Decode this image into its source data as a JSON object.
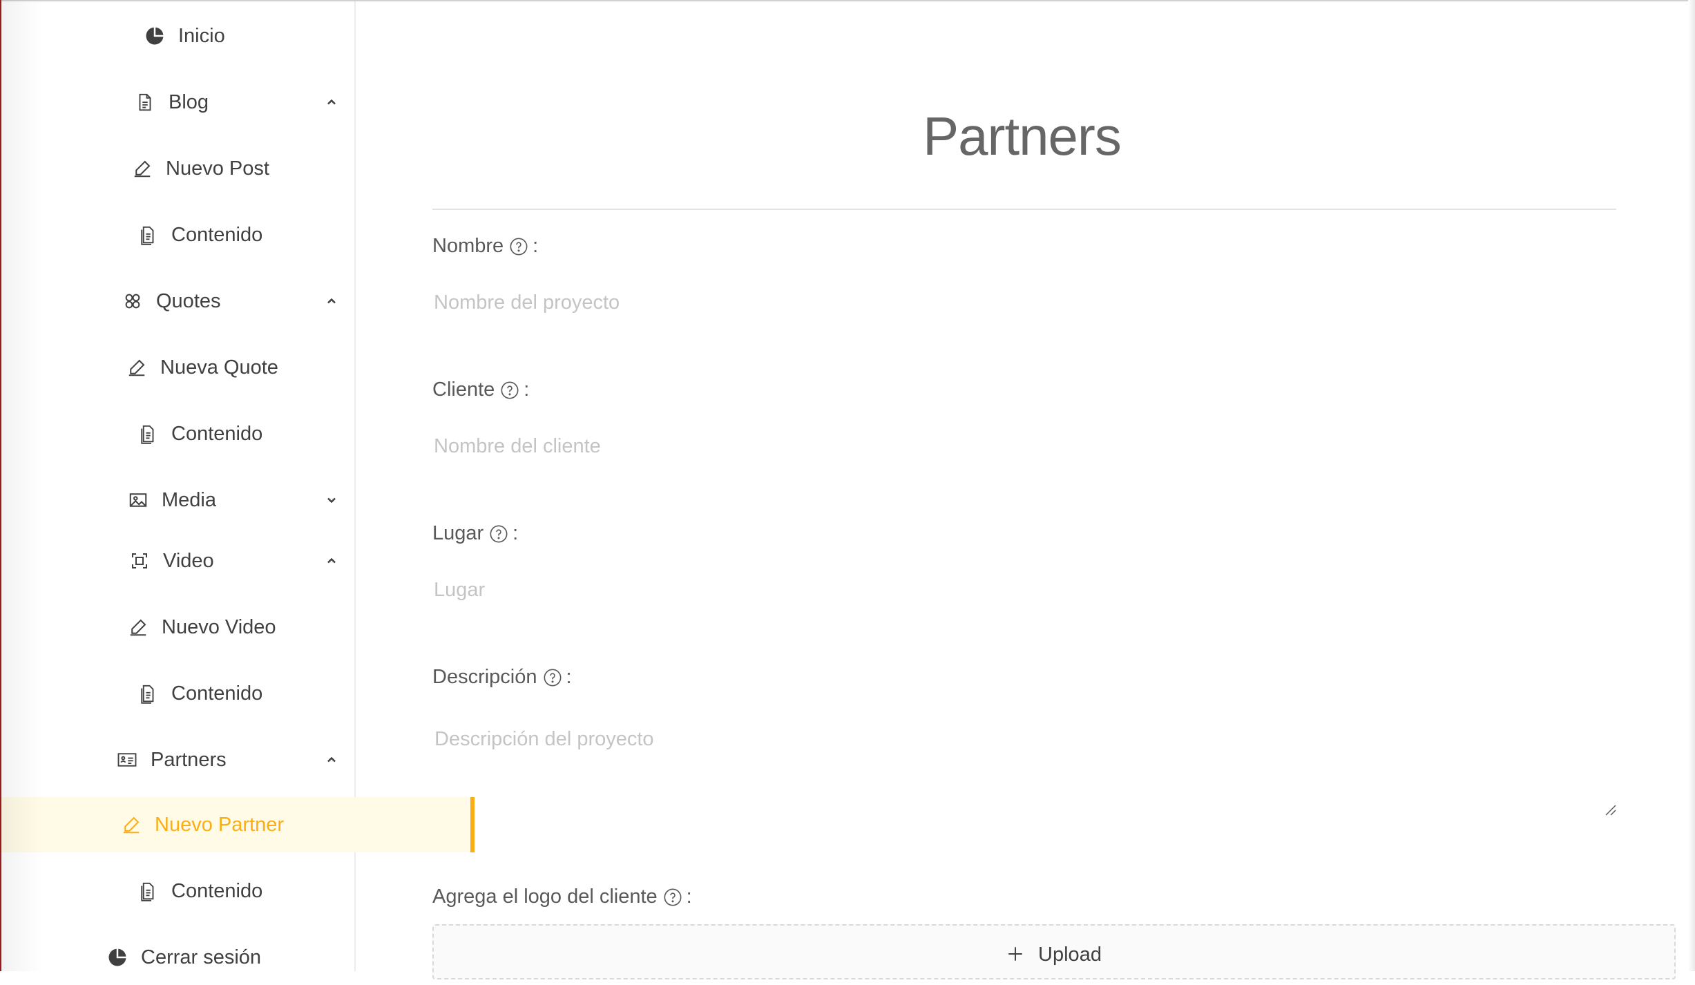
{
  "sidebar": {
    "items": [
      {
        "label": "Inicio",
        "icon": "pie-chart-icon"
      },
      {
        "label": "Blog",
        "icon": "file-icon",
        "chevron": "up"
      },
      {
        "label": "Nuevo Post",
        "icon": "edit-icon"
      },
      {
        "label": "Contenido",
        "icon": "file-text-icon"
      },
      {
        "label": "Quotes",
        "icon": "appstore-icon",
        "chevron": "up"
      },
      {
        "label": "Nueva Quote",
        "icon": "edit-icon"
      },
      {
        "label": "Contenido",
        "icon": "file-text-icon"
      },
      {
        "label": "Media",
        "icon": "picture-icon",
        "chevron": "down"
      },
      {
        "label": "Video",
        "icon": "scan-icon",
        "chevron": "up"
      },
      {
        "label": "Nuevo Video",
        "icon": "edit-icon"
      },
      {
        "label": "Contenido",
        "icon": "file-text-icon"
      },
      {
        "label": "Partners",
        "icon": "idcard-icon",
        "chevron": "up"
      },
      {
        "label": "Nuevo Partner",
        "icon": "edit-icon",
        "active": true
      },
      {
        "label": "Contenido",
        "icon": "file-text-icon"
      },
      {
        "label": "Cerrar sesión",
        "icon": "pie-chart-icon"
      }
    ],
    "active_color": "#faad14",
    "active_bg": "#fffbe6"
  },
  "main": {
    "title": "Partners",
    "form": {
      "nombre": {
        "label": "Nombre",
        "placeholder": "Nombre del proyecto"
      },
      "cliente": {
        "label": "Cliente",
        "placeholder": "Nombre del cliente"
      },
      "lugar": {
        "label": "Lugar",
        "placeholder": "Lugar"
      },
      "descripcion": {
        "label": "Descripción",
        "placeholder": "Descripción del proyecto"
      },
      "logo": {
        "label": "Agrega el logo del cliente",
        "upload_label": "Upload"
      }
    },
    "colon": ":"
  }
}
